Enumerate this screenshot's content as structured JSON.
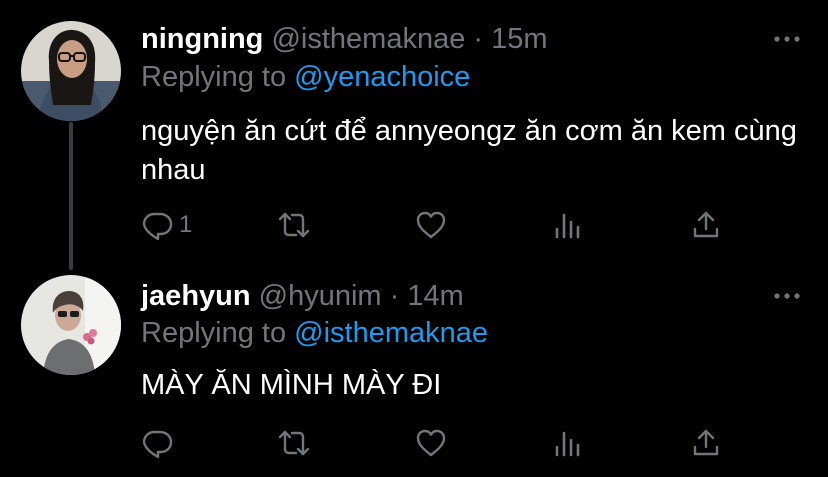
{
  "colors": {
    "background": "#000000",
    "name": "#ffffff",
    "meta": "#71767b",
    "mention": "#1d9bf0",
    "body": "#ffffff",
    "thread_line": "#3a3d40"
  },
  "tweets": [
    {
      "name": "ningning",
      "handle": "@isthemaknae",
      "separator": "·",
      "time": "15m",
      "replying_prefix": "Replying to ",
      "replying_to": "@yenachoice",
      "text": "nguyện ăn cứt để annyeongz ăn cơm ăn kem cùng nhau",
      "reply_count": "1",
      "icons": [
        "more-icon",
        "reply-icon",
        "retweet-icon",
        "like-icon",
        "stats-icon",
        "share-icon"
      ]
    },
    {
      "name": "jaehyun",
      "handle": "@hyunim",
      "separator": "·",
      "time": "14m",
      "replying_prefix": "Replying to ",
      "replying_to": "@isthemaknae",
      "text": "MÀY ĂN MÌNH MÀY ĐI",
      "reply_count": "",
      "icons": [
        "more-icon",
        "reply-icon",
        "retweet-icon",
        "like-icon",
        "stats-icon",
        "share-icon"
      ]
    }
  ]
}
